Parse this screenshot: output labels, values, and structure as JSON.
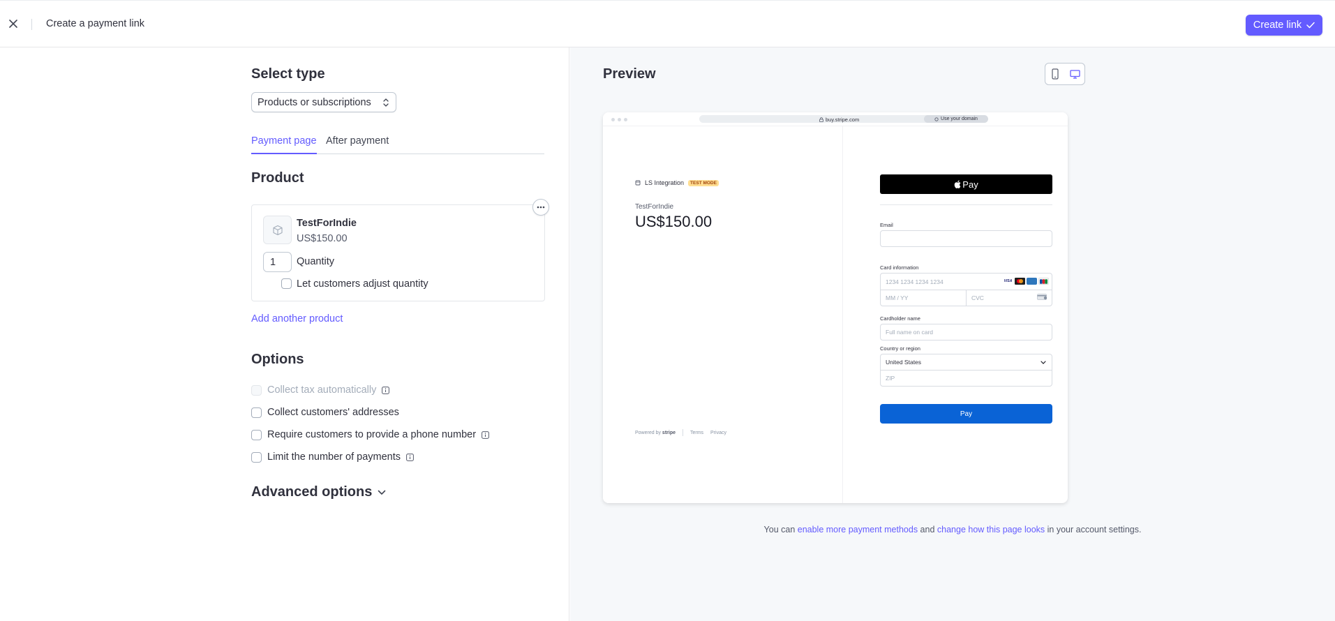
{
  "header": {
    "title": "Create a payment link",
    "create_label": "Create link"
  },
  "form": {
    "select_type_heading": "Select type",
    "type_value": "Products or subscriptions",
    "tabs": [
      {
        "label": "Payment page",
        "active": true
      },
      {
        "label": "After payment",
        "active": false
      }
    ],
    "product_heading": "Product",
    "product": {
      "name": "TestForIndie",
      "price": "US$150.00",
      "quantity": "1",
      "quantity_label": "Quantity",
      "adjust_label": "Let customers adjust quantity"
    },
    "add_product_label": "Add another product",
    "options_heading": "Options",
    "options": [
      {
        "label": "Collect tax automatically",
        "disabled": true,
        "info": true
      },
      {
        "label": "Collect customers' addresses",
        "disabled": false,
        "info": false
      },
      {
        "label": "Require customers to provide a phone number",
        "disabled": false,
        "info": true
      },
      {
        "label": "Limit the number of payments",
        "disabled": false,
        "info": true
      }
    ],
    "advanced_label": "Advanced options"
  },
  "preview": {
    "heading": "Preview",
    "url": "buy.stripe.com",
    "domain_label": "Use your domain",
    "merchant": "LS Integration",
    "test_badge": "TEST MODE",
    "product_name": "TestForIndie",
    "price": "US$150.00",
    "apple_pay_label": "Pay",
    "email_label": "Email",
    "card_label": "Card information",
    "card_placeholder": "1234 1234 1234 1234",
    "exp_placeholder": "MM / YY",
    "cvc_placeholder": "CVC",
    "cardholder_label": "Cardholder name",
    "cardholder_placeholder": "Full name on card",
    "country_label": "Country or region",
    "country_value": "United States",
    "zip_placeholder": "ZIP",
    "pay_label": "Pay",
    "powered_by": "Powered by",
    "stripe_word": "stripe",
    "terms": "Terms",
    "privacy": "Privacy",
    "card_brands": [
      "VISA",
      "MC",
      "AMEX",
      "JCB"
    ]
  },
  "note": {
    "t1": "You can ",
    "link1": "enable more payment methods",
    "t2": " and ",
    "link2": "change how this page looks",
    "t3": " in your account settings."
  },
  "colors": {
    "accent": "#635bff",
    "pay_button": "#0a63d6",
    "test_badge_bg": "#ffde92"
  }
}
